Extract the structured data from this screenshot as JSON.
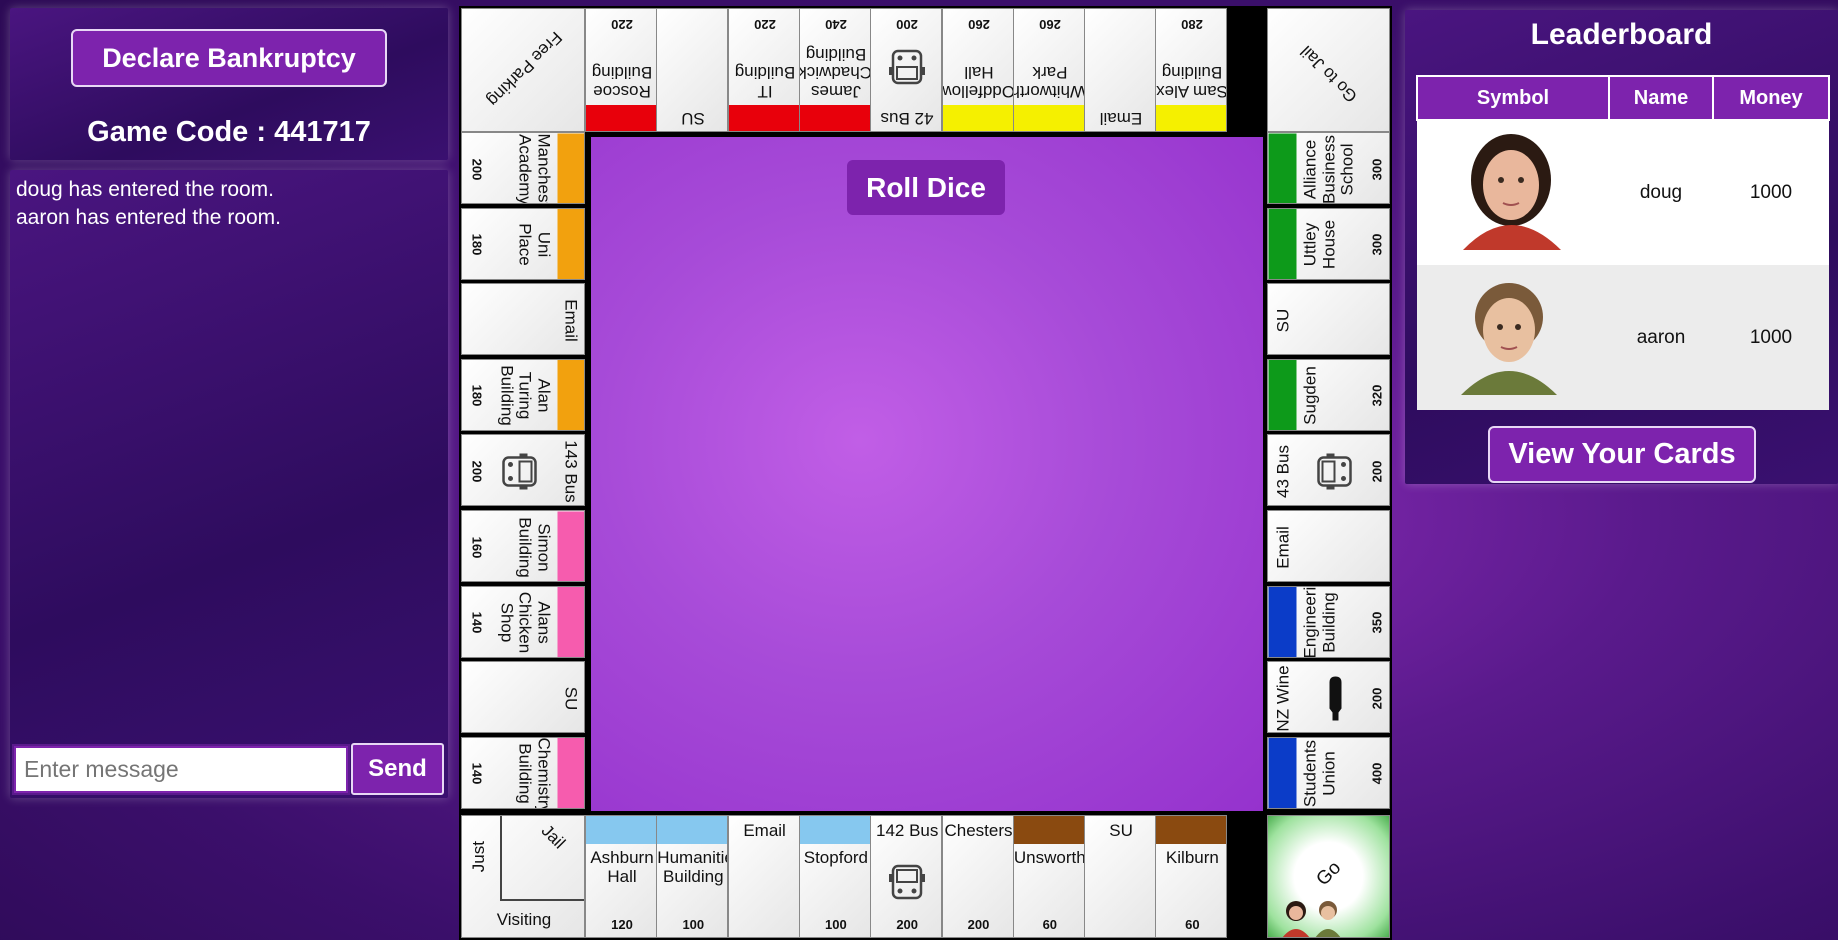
{
  "left_panel": {
    "bankrupt_label": "Declare Bankruptcy",
    "game_code_label": "Game Code : 441717",
    "messages": [
      "doug has entered the room.",
      "aaron has entered the room."
    ],
    "message_placeholder": "Enter message",
    "send_label": "Send"
  },
  "board": {
    "roll_label": "Roll Dice",
    "corners": {
      "free_parking": "Free Parking",
      "go_to_jail": "Go to Jail",
      "go": "Go",
      "jail": "Jail",
      "just": "Just",
      "visiting": "Visiting"
    },
    "top": [
      {
        "name": "Roscoe Building",
        "price": "220",
        "color": "#e8000b"
      },
      {
        "name": "SU",
        "price": "",
        "color": ""
      },
      {
        "name": "IT Building",
        "price": "220",
        "color": "#e8000b"
      },
      {
        "name": "James Chadwick Building",
        "price": "240",
        "color": "#e8000b"
      },
      {
        "name": "42 Bus",
        "price": "200",
        "color": "",
        "icon": "bus-icon"
      },
      {
        "name": "Oddfellows Hall",
        "price": "260",
        "color": "#f5f000"
      },
      {
        "name": "Whitworth Park",
        "price": "260",
        "color": "#f5f000"
      },
      {
        "name": "Email",
        "price": "",
        "color": ""
      },
      {
        "name": "Sam Alex Building",
        "price": "280",
        "color": "#f5f000"
      }
    ],
    "left": [
      {
        "name": "Manchester Academy",
        "price": "200",
        "color": "#f2a10e"
      },
      {
        "name": "Uni Place",
        "price": "180",
        "color": "#f2a10e"
      },
      {
        "name": "Email",
        "price": "",
        "color": ""
      },
      {
        "name": "Alan Turing Building",
        "price": "180",
        "color": "#f2a10e"
      },
      {
        "name": "143 Bus",
        "price": "200",
        "color": "",
        "icon": "bus-icon"
      },
      {
        "name": "Simon Building",
        "price": "160",
        "color": "#f65cae"
      },
      {
        "name": "Alans Chicken Shop",
        "price": "140",
        "color": "#f65cae"
      },
      {
        "name": "SU",
        "price": "",
        "color": ""
      },
      {
        "name": "Chemistry Building",
        "price": "140",
        "color": "#f65cae"
      }
    ],
    "right": [
      {
        "name": "Alliance Business School",
        "price": "300",
        "color": "#0d9a1a"
      },
      {
        "name": "Uttley House",
        "price": "300",
        "color": "#0d9a1a"
      },
      {
        "name": "SU",
        "price": "",
        "color": ""
      },
      {
        "name": "Sugden",
        "price": "320",
        "color": "#0d9a1a"
      },
      {
        "name": "43 Bus",
        "price": "200",
        "color": "",
        "icon": "bus-icon"
      },
      {
        "name": "Email",
        "price": "",
        "color": ""
      },
      {
        "name": "Engineering Building",
        "price": "350",
        "color": "#0b3cc8"
      },
      {
        "name": "NZ Wine",
        "price": "200",
        "color": "",
        "icon": "bottle-icon"
      },
      {
        "name": "Students Union",
        "price": "400",
        "color": "#0b3cc8"
      }
    ],
    "bottom": [
      {
        "name": "Ashburn Hall",
        "price": "120",
        "color": "#86c8ef"
      },
      {
        "name": "Humanities Building",
        "price": "100",
        "color": "#86c8ef"
      },
      {
        "name": "Email",
        "price": "",
        "color": ""
      },
      {
        "name": "Stopford",
        "price": "100",
        "color": "#86c8ef"
      },
      {
        "name": "142 Bus",
        "price": "200",
        "color": "",
        "icon": "bus-icon"
      },
      {
        "name": "Chesters",
        "price": "200",
        "color": ""
      },
      {
        "name": "Unsworth",
        "price": "60",
        "color": "#8a4a10"
      },
      {
        "name": "SU",
        "price": "",
        "color": ""
      },
      {
        "name": "Kilburn",
        "price": "60",
        "color": "#8a4a10"
      }
    ]
  },
  "leaderboard": {
    "title": "Leaderboard",
    "headers": [
      "Symbol",
      "Name",
      "Money"
    ],
    "players": [
      {
        "name": "doug",
        "money": "1000"
      },
      {
        "name": "aaron",
        "money": "1000"
      }
    ],
    "view_cards_label": "View Your Cards"
  },
  "colors": {
    "accent": "#7d23ad",
    "background": "#4a1580"
  }
}
